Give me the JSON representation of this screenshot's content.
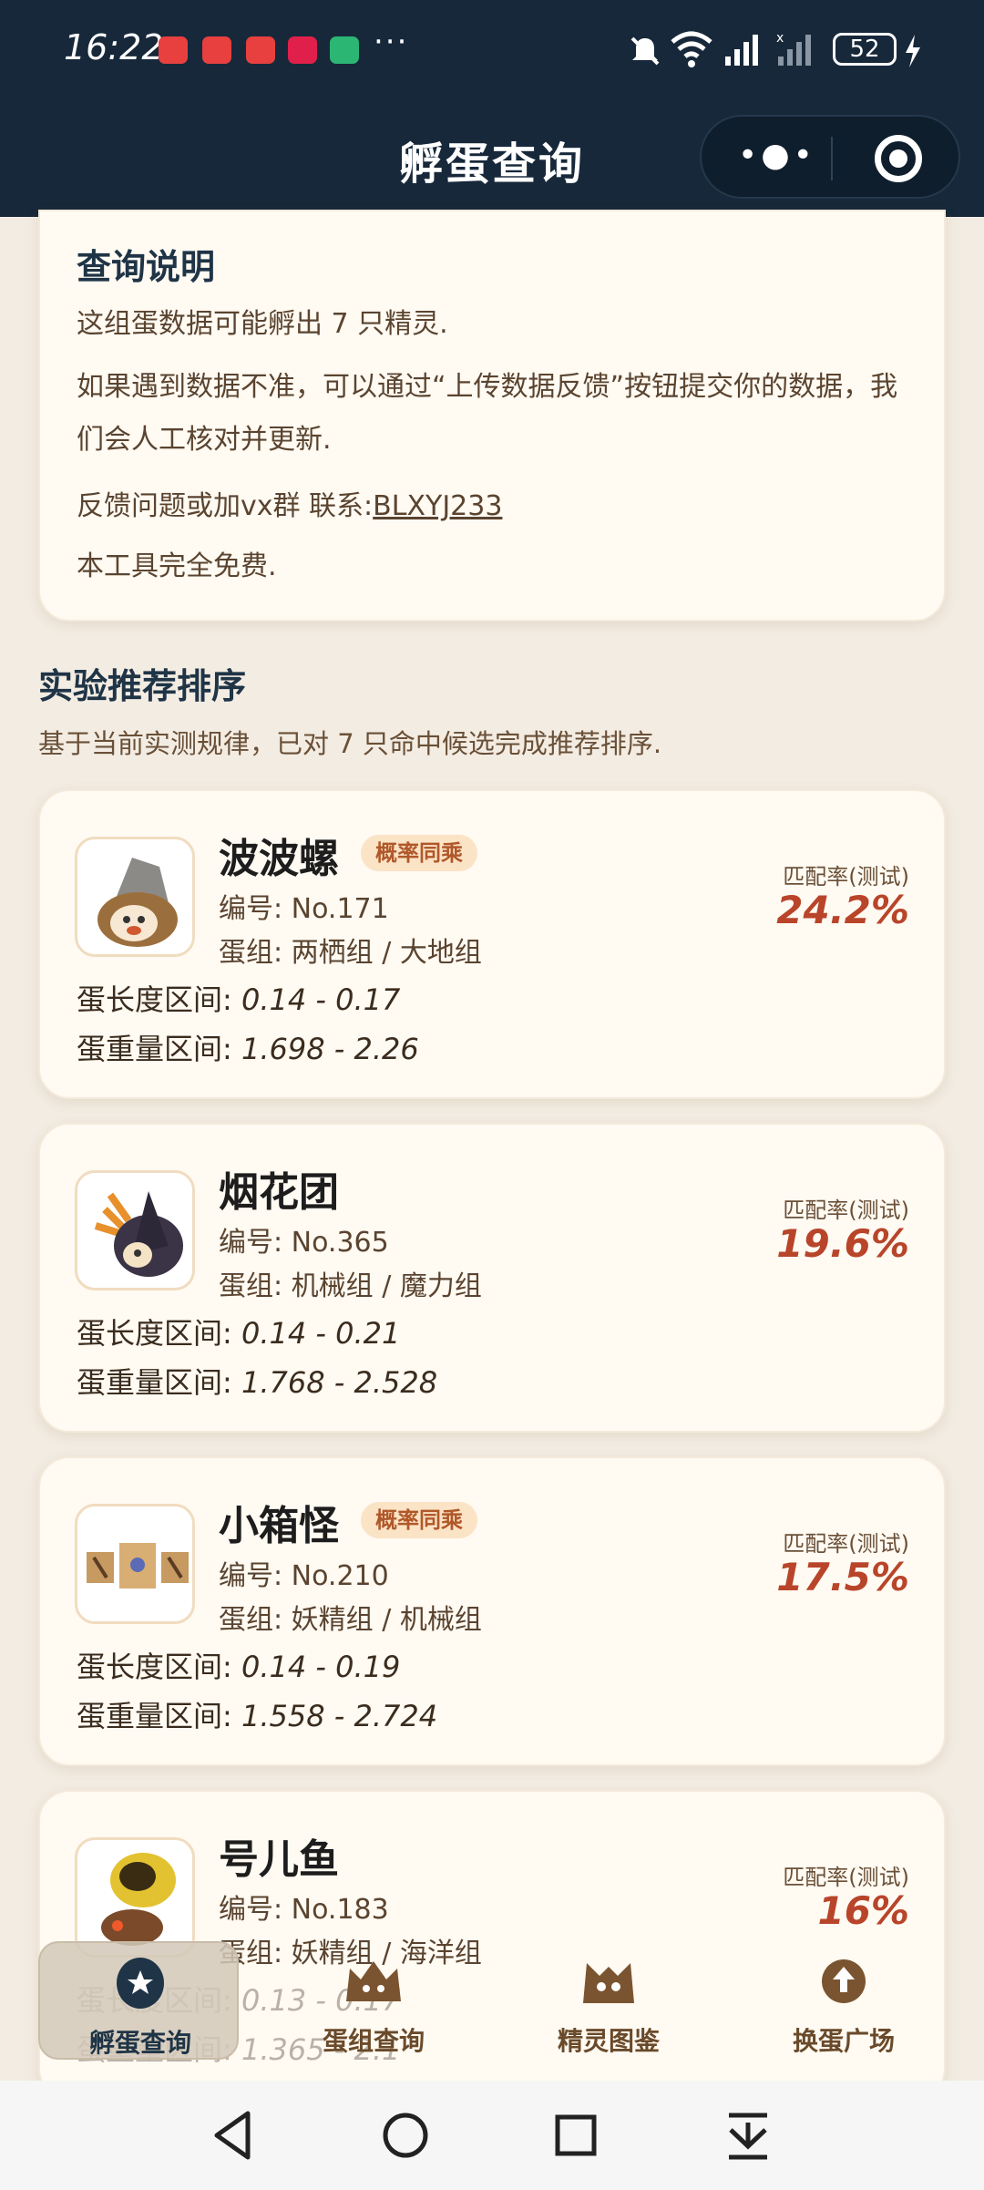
{
  "status_bar": {
    "time": "16:22",
    "more": "···",
    "battery": "52"
  },
  "header": {
    "title": "孵蛋查询",
    "menu_icon": "more-dots-icon",
    "close_icon": "target-icon"
  },
  "info": {
    "title": "查询说明",
    "line1": "这组蛋数据可能孵出 7 只精灵.",
    "line2": "如果遇到数据不准，可以通过“上传数据反馈”按钮提交你的数据，我们会人工核对并更新.",
    "contact_prefix": "反馈问题或加vx群 联系:",
    "contact_id": "BLXYJ233",
    "line4": "本工具完全免费."
  },
  "section": {
    "title": "实验推荐排序",
    "subtitle": "基于当前实测规律，已对 7 只命中候选完成推荐排序."
  },
  "match_label": "匹配率(测试)",
  "labels": {
    "number": "编号:",
    "egg_group": "蛋组:",
    "length": "蛋长度区间:",
    "weight": "蛋重量区间:"
  },
  "monsters": [
    {
      "name": "波波螺",
      "badge": "概率同乘",
      "number": "No.171",
      "groups": "两栖组 / 大地组",
      "length": "0.14 - 0.17",
      "weight": "1.698 - 2.26",
      "match": "24.2%"
    },
    {
      "name": "烟花团",
      "badge": "",
      "number": "No.365",
      "groups": "机械组 / 魔力组",
      "length": "0.14 - 0.21",
      "weight": "1.768 - 2.528",
      "match": "19.6%"
    },
    {
      "name": "小箱怪",
      "badge": "概率同乘",
      "number": "No.210",
      "groups": "妖精组 / 机械组",
      "length": "0.14 - 0.19",
      "weight": "1.558 - 2.724",
      "match": "17.5%"
    },
    {
      "name": "号儿鱼",
      "badge": "",
      "number": "No.183",
      "groups": "妖精组 / 海洋组",
      "length": "0.13 - 0.17",
      "weight": "1.365 - 2.1",
      "match": "16%"
    }
  ],
  "tabs": [
    {
      "label": "孵蛋查询",
      "icon": "egg-star-icon",
      "active": true
    },
    {
      "label": "蛋组查询",
      "icon": "creature-group-icon",
      "active": false
    },
    {
      "label": "精灵图鉴",
      "icon": "monster-book-icon",
      "active": false
    },
    {
      "label": "换蛋广场",
      "icon": "exchange-icon",
      "active": false
    }
  ],
  "colors": {
    "header_bg": "#17283a",
    "page_bg": "#f3ece2",
    "card_bg": "#fffaf2",
    "match_color": "#b8452a",
    "badge_bg": "#fbe3c6",
    "badge_text": "#b0582a"
  }
}
